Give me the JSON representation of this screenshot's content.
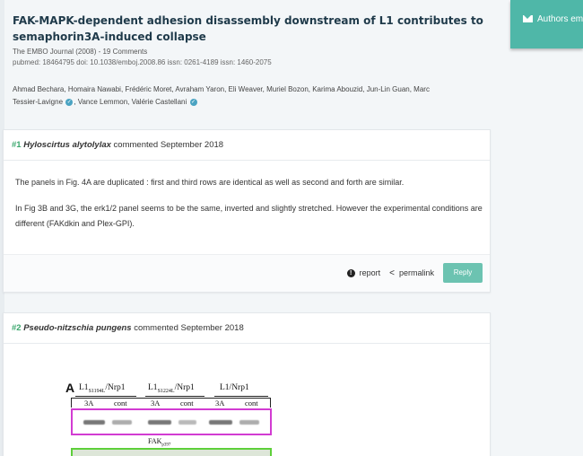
{
  "paper": {
    "title_line1": "FAK-MAPK-dependent adhesion disassembly downstream of L1 contributes to",
    "title_line2": "semaphorin3A-induced collapse",
    "journal": "The EMBO Journal (2008) - 19 Comments",
    "identifiers": "pubmed: 18464795  doi: 10.1038/emboj.2008.86  issn: 0261-4189  issn: 1460-2075",
    "authors_line1": "Ahmad Bechara, Homaira Nawabi, Frédéric Moret, Avraham Yaron, Eli Weaver, Muriel Bozon, Karima Abouzid, Jun-Lin Guan, Marc",
    "authors_line2a": "Tessier-Lavigne",
    "authors_line2b": ", Vance Lemmon, Valérie Castellani"
  },
  "side_tab": {
    "label": "Authors em"
  },
  "comments": [
    {
      "number": "#1",
      "author": "Hyloscirtus alytolylax",
      "meta": "commented September 2018",
      "paragraph1": "The panels in Fig. 4A are duplicated : first and third rows are identical as well as second and forth are similar.",
      "paragraph2": "In Fig 3B and 3G, the erk1/2 panel seems to be the same, inverted and slightly stretched. However the experimental conditions are different (FAKdkin and Plex-GPI).",
      "actions": {
        "report": "report",
        "permalink": "permalink",
        "reply": "Reply"
      }
    },
    {
      "number": "#2",
      "author": "Pseudo-nitzschia pungens",
      "meta": "commented September 2018",
      "figure": {
        "panel_letter": "A",
        "constructs": [
          {
            "base": "L1",
            "sub": "S1194L",
            "suffix": "/Nrp1"
          },
          {
            "base": "L1",
            "sub": "S1224L",
            "suffix": "/Nrp1"
          },
          {
            "base": "L1/Nrp1",
            "sub": "",
            "suffix": ""
          }
        ],
        "lanes": [
          "3A",
          "cont",
          "3A",
          "cont",
          "3A",
          "cont"
        ],
        "blot_label": "FAK",
        "blot_label_sub": "p397",
        "highlight_colors": {
          "top": "#d23cd2",
          "bottom": "#5ecf3a"
        }
      }
    }
  ],
  "colors": {
    "accent": "#4fb7a8",
    "reply_button": "#6cc3b1",
    "comment_number": "#3aa76d",
    "title": "#1f3a4a"
  }
}
